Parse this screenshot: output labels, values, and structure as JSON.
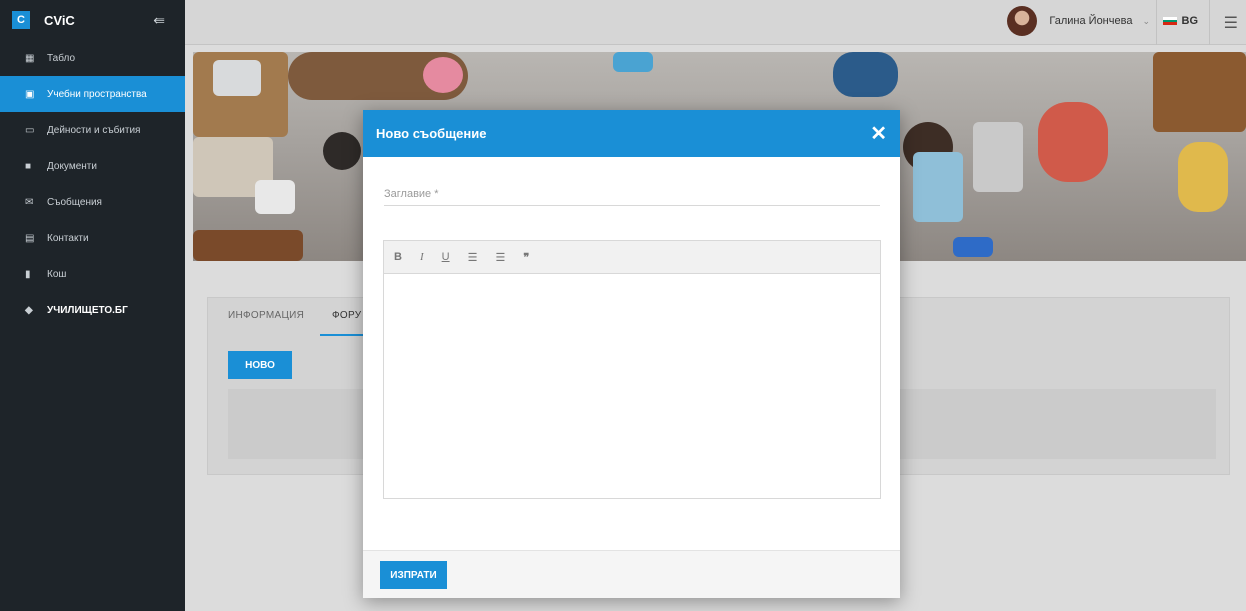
{
  "brand": {
    "logo_letter": "C",
    "name": "CViC",
    "collapse_icon": "collapse-left-icon"
  },
  "sidebar": {
    "items": [
      {
        "label": "Табло",
        "icon": "grid-icon"
      },
      {
        "label": "Учебни пространства",
        "icon": "school-icon"
      },
      {
        "label": "Дейности и събития",
        "icon": "calendar-icon"
      },
      {
        "label": "Документи",
        "icon": "folder-icon"
      },
      {
        "label": "Съобщения",
        "icon": "envelope-icon"
      },
      {
        "label": "Контакти",
        "icon": "contact-card-icon"
      },
      {
        "label": "Кош",
        "icon": "trash-icon"
      },
      {
        "label": "УЧИЛИЩЕТО.БГ",
        "icon": "graduation-cap-icon"
      }
    ]
  },
  "topbar": {
    "user_name": "Галина Йончева",
    "language": "BG"
  },
  "tabs": [
    {
      "label": "ИНФОРМАЦИЯ"
    },
    {
      "label": "ФОРУ"
    }
  ],
  "main": {
    "new_button": "НОВО"
  },
  "modal": {
    "title": "Ново съобщение",
    "title_placeholder": "Заглавие *",
    "toolbar": {
      "bold": "B",
      "italic": "I",
      "underline": "U",
      "bullets": "☰",
      "numbered": "☰",
      "quote": "❞"
    },
    "send_button": "ИЗПРАТИ"
  },
  "colors": {
    "accent": "#1a8fd6",
    "sidebar_bg": "#1e2429"
  }
}
